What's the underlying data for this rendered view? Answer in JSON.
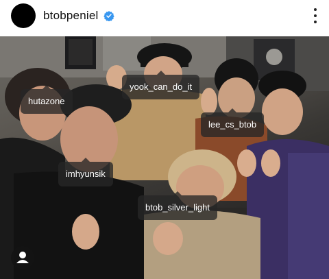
{
  "header": {
    "username": "btobpeniel",
    "verified": true,
    "verified_color": "#3897f0",
    "avatar_icon": "black-avatar-circle",
    "more_icon": "more-vertical-icon"
  },
  "post": {
    "tags": [
      {
        "username": "hutazone"
      },
      {
        "username": "yook_can_do_it"
      },
      {
        "username": "lee_cs_btob"
      },
      {
        "username": "imhyunsik"
      },
      {
        "username": "btob_silver_light"
      }
    ],
    "tagged_users_icon": "person-icon"
  }
}
